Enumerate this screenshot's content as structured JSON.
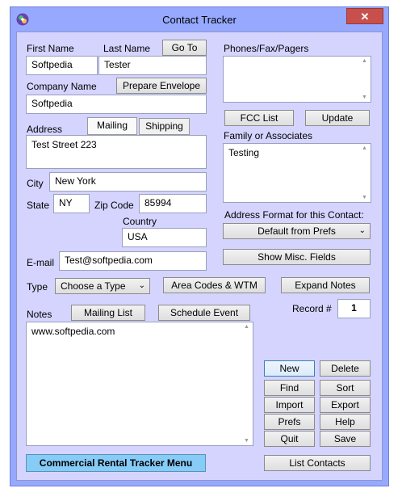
{
  "window": {
    "title": "Contact Tracker",
    "close_symbol": "✕"
  },
  "labels": {
    "first_name": "First Name",
    "last_name": "Last Name",
    "company_name": "Company Name",
    "address": "Address",
    "city": "City",
    "state": "State",
    "zip_code": "Zip Code",
    "country": "Country",
    "email": "E-mail",
    "type": "Type",
    "notes": "Notes",
    "phones": "Phones/Fax/Pagers",
    "family": "Family or Associates",
    "address_format": "Address Format for this Contact:",
    "record": "Record #"
  },
  "fields": {
    "first_name": "Softpedia",
    "last_name": "Tester",
    "company_name": "Softpedia",
    "address": "Test Street 223",
    "city": "New York",
    "state": "NY",
    "zip_code": "85994",
    "country": "USA",
    "email": "Test@softpedia.com",
    "type": "Choose a Type",
    "notes": "www.softpedia.com",
    "phones": "",
    "family": "Testing",
    "address_format": "Default from Prefs",
    "record": "1"
  },
  "tabs": {
    "mailing": "Mailing",
    "shipping": "Shipping"
  },
  "buttons": {
    "go_to": "Go To",
    "prepare_envelope": "Prepare Envelope",
    "fcc_list": "FCC List",
    "update": "Update",
    "show_misc": "Show Misc. Fields",
    "area_codes": "Area Codes & WTM",
    "expand_notes": "Expand Notes",
    "mailing_list": "Mailing List",
    "schedule_event": "Schedule Event",
    "new": "New",
    "delete": "Delete",
    "find": "Find",
    "sort": "Sort",
    "import": "Import",
    "export": "Export",
    "prefs": "Prefs",
    "help": "Help",
    "quit": "Quit",
    "save": "Save",
    "commercial_menu": "Commercial Rental Tracker Menu",
    "list_contacts": "List Contacts"
  }
}
